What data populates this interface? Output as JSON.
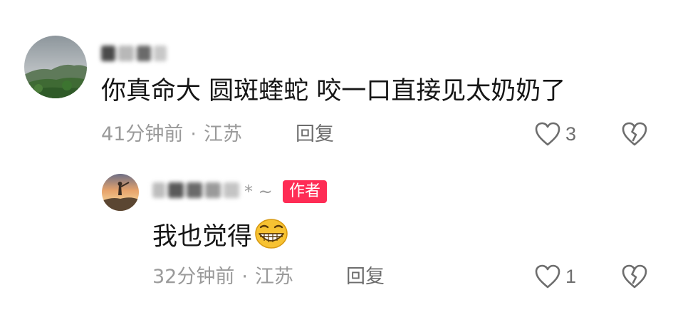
{
  "comment": {
    "username": "[blurred]",
    "text": "你真命大   圆斑蝰蛇 咬一口直接见太奶奶了",
    "time": "41分钟前",
    "separator": "·",
    "location": "江苏",
    "reply_label": "回复",
    "likes": "3",
    "icons": {
      "like": "heart-outline-icon",
      "dislike": "broken-heart-icon"
    }
  },
  "reply": {
    "username": "[blurred]",
    "name_suffix": "* ~",
    "badge": "作者",
    "text": "我也觉得",
    "emoji": "grinning-face-emoji",
    "time": "32分钟前",
    "separator": "·",
    "location": "江苏",
    "reply_label": "回复",
    "likes": "1",
    "icons": {
      "like": "heart-outline-icon",
      "dislike": "broken-heart-icon"
    }
  },
  "colors": {
    "badge": "#fe2c55",
    "text_primary": "#161616",
    "text_secondary": "#9a9a9a",
    "icon": "#6d6d6d"
  }
}
